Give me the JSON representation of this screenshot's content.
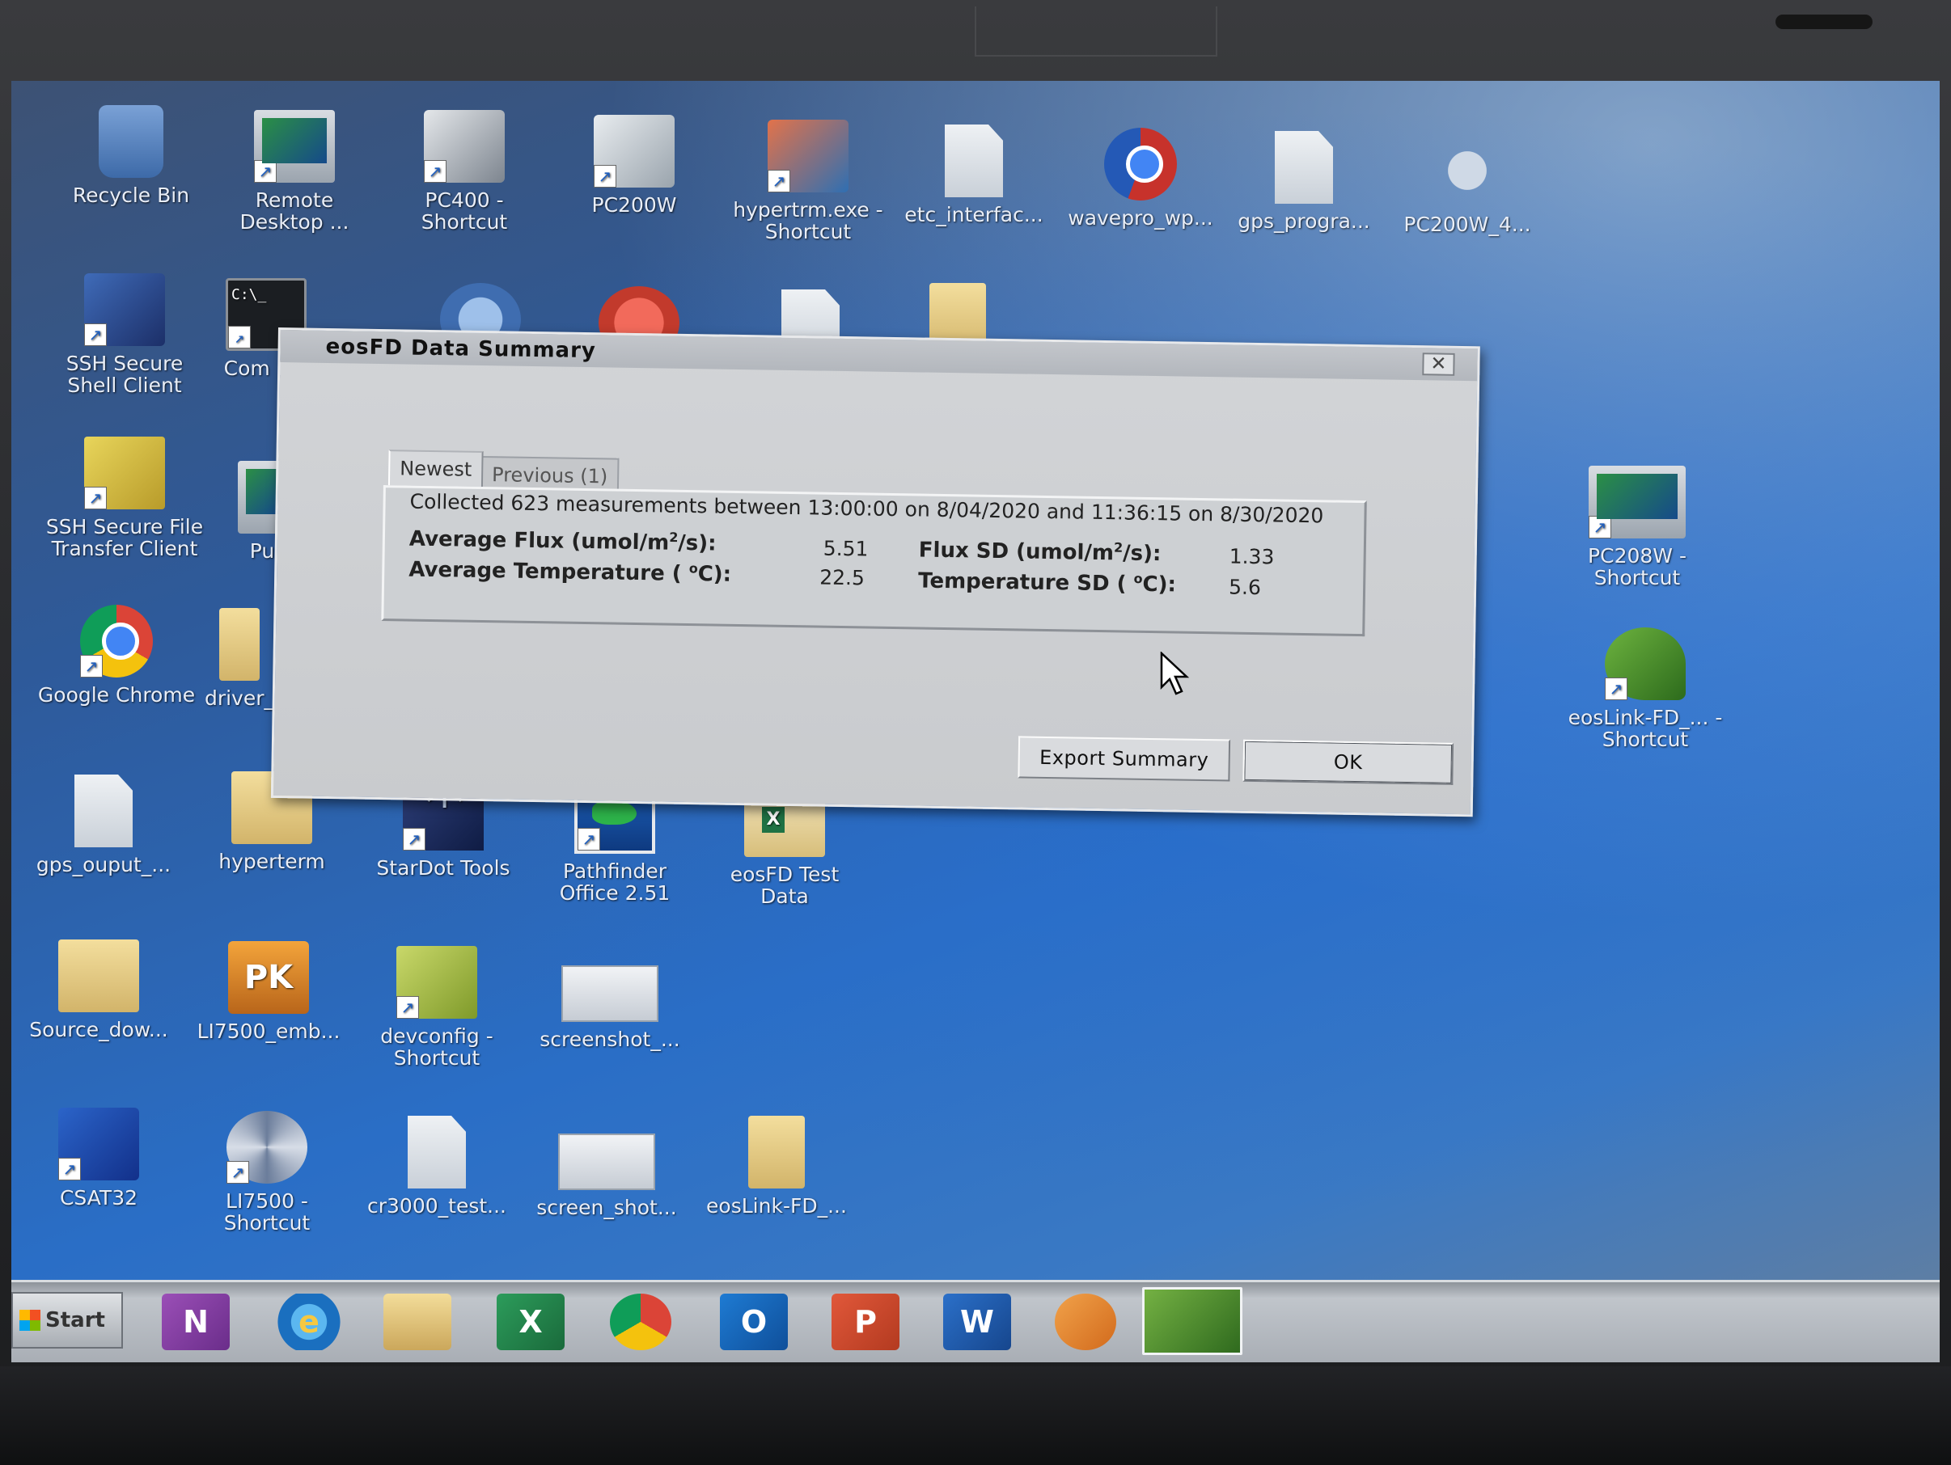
{
  "desktop": {
    "icons": [
      {
        "label": "Recycle Bin",
        "icon": "recycle-bin-icon"
      },
      {
        "label": "Remote Desktop ...",
        "icon": "remote-desktop-icon"
      },
      {
        "label": "PC400 - Shortcut",
        "icon": "pc400-icon"
      },
      {
        "label": "PC200W",
        "icon": "pc200w-icon"
      },
      {
        "label": "hypertrm.exe - Shortcut",
        "icon": "hyperterminal-icon"
      },
      {
        "label": "etc_interfac...",
        "icon": "text-document-icon"
      },
      {
        "label": "wavepro_wp...",
        "icon": "wavepro-icon"
      },
      {
        "label": "gps_progra...",
        "icon": "document-icon"
      },
      {
        "label": "PC200W_4...",
        "icon": "pc200w-installer-icon"
      },
      {
        "label": "SSH Secure Shell Client",
        "icon": "ssh-client-icon"
      },
      {
        "label": "Com Pro",
        "icon": "command-prompt-icon"
      },
      {
        "label": "SSH Secure File Transfer Client",
        "icon": "ssh-file-transfer-icon"
      },
      {
        "label": "Pu",
        "icon": "putty-icon"
      },
      {
        "label": "Google Chrome",
        "icon": "chrome-icon"
      },
      {
        "label": "driver_",
        "icon": "folder-icon"
      },
      {
        "label": "PC208W - Shortcut",
        "icon": "pc208w-icon"
      },
      {
        "label": "eosLink-FD_... - Shortcut",
        "icon": "eoslink-icon"
      },
      {
        "label": "gps_ouput_...",
        "icon": "document-icon"
      },
      {
        "label": "hyperterm",
        "icon": "folder-icon"
      },
      {
        "label": "StarDot Tools",
        "icon": "stardot-icon"
      },
      {
        "label": "Pathfinder Office 2.51",
        "icon": "pathfinder-icon"
      },
      {
        "label": "eosFD Test Data",
        "icon": "excel-folder-icon"
      },
      {
        "label": "Source_dow...",
        "icon": "folder-icon"
      },
      {
        "label": "LI7500_emb...",
        "icon": "pk-archive-icon"
      },
      {
        "label": "devconfig - Shortcut",
        "icon": "devconfig-icon"
      },
      {
        "label": "screenshot_...",
        "icon": "screenshot-icon"
      },
      {
        "label": "CSAT32",
        "icon": "csat32-icon"
      },
      {
        "label": "LI7500 - Shortcut",
        "icon": "li7500-icon"
      },
      {
        "label": "cr3000_test...",
        "icon": "document-icon"
      },
      {
        "label": "screen_shot...",
        "icon": "screenshot-icon"
      },
      {
        "label": "eosLink-FD_...",
        "icon": "folder-icon"
      }
    ]
  },
  "dialog": {
    "title": "eosFD Data Summary",
    "close_glyph": "✕",
    "tabs": [
      "Newest",
      "Previous (1)"
    ],
    "collected": "Collected 623 measurements between 13:00:00 on 8/04/2020 and 11:36:15 on 8/30/2020",
    "stats": {
      "avg_flux_label_pre": "Average Flux (umol/m",
      "avg_flux_label_post": "/s):",
      "avg_flux_value": "5.51",
      "avg_temp_label_pre": "Average Temperature ( ",
      "avg_temp_label_post": "C):",
      "avg_temp_value": "22.5",
      "flux_sd_label_pre": "Flux SD (umol/m",
      "flux_sd_label_post": "/s):",
      "flux_sd_value": "1.33",
      "temp_sd_label_pre": "Temperature SD ( ",
      "temp_sd_label_post": "C):",
      "temp_sd_value": "5.6",
      "superscript_two": "2",
      "superscript_degree": "o"
    },
    "buttons": {
      "export": "Export Summary",
      "ok": "OK"
    }
  },
  "taskbar": {
    "start_label": "Start",
    "items": [
      "onenote-icon",
      "internet-explorer-icon",
      "explorer-folder-icon",
      "excel-icon",
      "chrome-icon",
      "outlook-icon",
      "powerpoint-icon",
      "word-icon",
      "media-player-icon",
      "eoslink-taskbar-icon"
    ],
    "glyphs": {
      "onenote": "N",
      "excel": "X",
      "outlook": "O",
      "ppt": "P",
      "word": "W",
      "ie": "e"
    }
  }
}
